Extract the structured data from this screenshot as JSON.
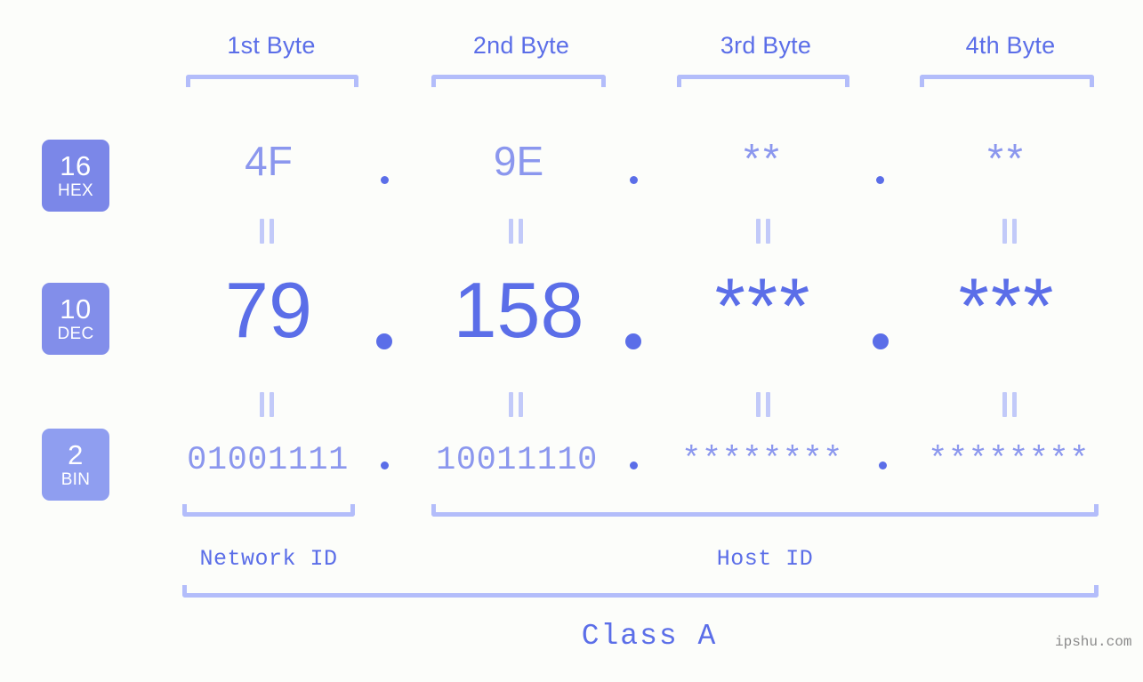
{
  "background_color": "#fcfdfa",
  "accent_colors": {
    "strong_blue": "#5b6ee8",
    "light_blue": "#8b97ee",
    "bracket_blue": "#b3bdfa",
    "equals_blue": "#c2caf9",
    "badge_hex": "#7b87e8",
    "badge_dec": "#828eea",
    "badge_bin": "#8f9ef0",
    "watermark_gray": "#8b8b8b"
  },
  "byte_headers": [
    {
      "label": "1st Byte"
    },
    {
      "label": "2nd Byte"
    },
    {
      "label": "3rd Byte"
    },
    {
      "label": "4th Byte"
    }
  ],
  "radix_rows": [
    {
      "number": "16",
      "name": "HEX",
      "color": "#7b87e8"
    },
    {
      "number": "10",
      "name": "DEC",
      "color": "#828eea"
    },
    {
      "number": "2",
      "name": "BIN",
      "color": "#8f9ef0"
    }
  ],
  "hex_row": {
    "values": [
      "4F",
      "9E",
      "**",
      "**"
    ],
    "separator": "."
  },
  "dec_row": {
    "values": [
      "79",
      "158",
      "***",
      "***"
    ],
    "separator": "."
  },
  "bin_row": {
    "values": [
      "01001111",
      "10011110",
      "********",
      "********"
    ],
    "separator": "."
  },
  "equals_marker": "||",
  "segments": {
    "network_id_label": "Network ID",
    "host_id_label": "Host ID",
    "class_label": "Class A"
  },
  "watermark": "ipshu.com"
}
